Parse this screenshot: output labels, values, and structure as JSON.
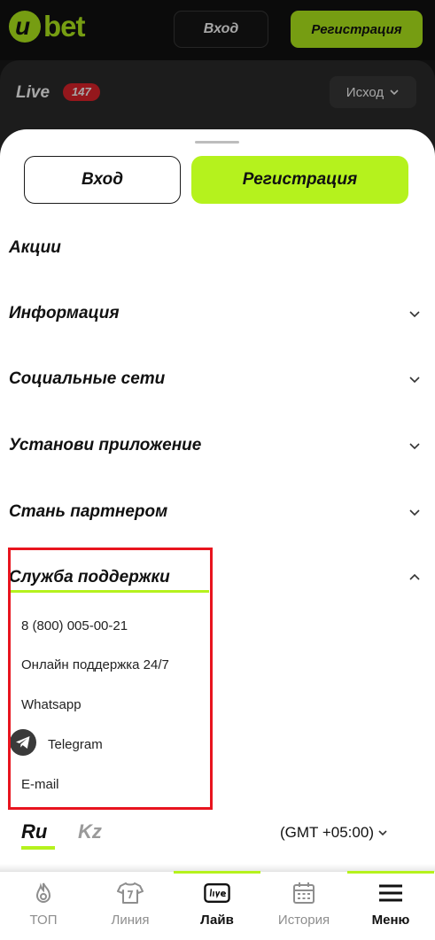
{
  "header": {
    "logo_letter": "u",
    "logo_text": "bet",
    "login_label": "Вход",
    "register_label": "Регистрация"
  },
  "background_page": {
    "live_label": "Live",
    "live_count": "147",
    "outcome_label": "Исход"
  },
  "sheet": {
    "login_label": "Вход",
    "register_label": "Регистрация",
    "menu": [
      {
        "label": "Акции",
        "chevron": "none"
      },
      {
        "label": "Информация",
        "chevron": "down"
      },
      {
        "label": "Социальные сети",
        "chevron": "down"
      },
      {
        "label": "Установи приложение",
        "chevron": "down"
      },
      {
        "label": "Стань партнером",
        "chevron": "down"
      },
      {
        "label": "Служба поддержки",
        "chevron": "up"
      }
    ],
    "support": {
      "phone": "8 (800) 005-00-21",
      "online": "Онлайн поддержка 24/7",
      "whatsapp": "Whatsapp",
      "telegram": "Telegram",
      "email": "E-mail"
    },
    "languages": {
      "active": "Ru",
      "other": "Kz"
    },
    "timezone": "(GMT +05:00)"
  },
  "bottom_nav": [
    {
      "label": "ТОП",
      "icon": "fire-icon",
      "active": false
    },
    {
      "label": "Линия",
      "icon": "jersey-icon",
      "active": false
    },
    {
      "label": "Лайв",
      "icon": "live-icon",
      "active": true
    },
    {
      "label": "История",
      "icon": "calendar-icon",
      "active": false
    },
    {
      "label": "Меню",
      "icon": "menu-icon",
      "active": true
    }
  ],
  "colors": {
    "accent": "#b5f21d",
    "badge_red": "#e3242b",
    "highlight_red": "#e8141e"
  }
}
